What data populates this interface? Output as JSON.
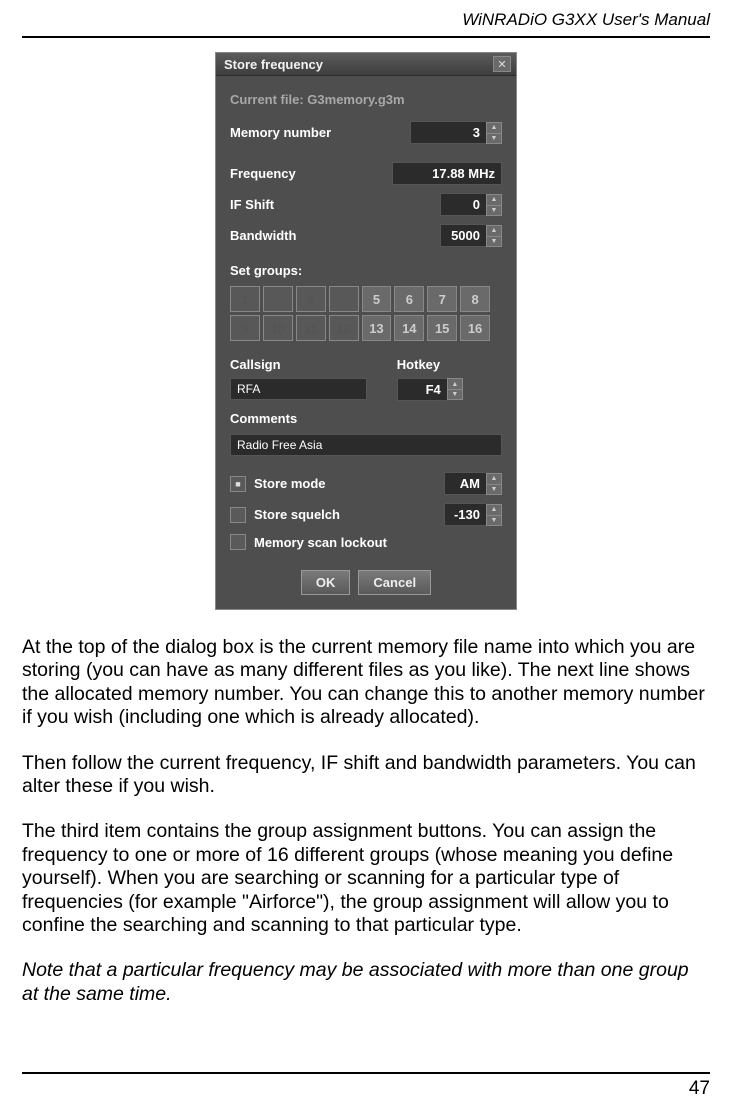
{
  "header": {
    "title": "WiNRADiO G3XX User's Manual"
  },
  "dialog": {
    "title": "Store frequency",
    "current_file_label": "Current file:",
    "current_file_value": "G3memory.g3m",
    "memory_number_label": "Memory number",
    "memory_number_value": "3",
    "frequency_label": "Frequency",
    "frequency_value": "17.88 MHz",
    "ifshift_label": "IF Shift",
    "ifshift_value": "0",
    "bandwidth_label": "Bandwidth",
    "bandwidth_value": "5000",
    "set_groups_label": "Set groups:",
    "groups": [
      "1",
      "",
      "3",
      "",
      "5",
      "6",
      "7",
      "8",
      "9",
      "10",
      "11",
      "12",
      "13",
      "14",
      "15",
      "16"
    ],
    "groups_dim": [
      true,
      true,
      true,
      true,
      false,
      false,
      false,
      false,
      true,
      true,
      true,
      true,
      false,
      false,
      false,
      false
    ],
    "callsign_label": "Callsign",
    "callsign_value": "RFA",
    "hotkey_label": "Hotkey",
    "hotkey_value": "F4",
    "comments_label": "Comments",
    "comments_value": "Radio Free Asia",
    "store_mode_label": "Store mode",
    "store_mode_value": "AM",
    "store_squelch_label": "Store squelch",
    "store_squelch_value": "-130",
    "lockout_label": "Memory scan lockout",
    "ok": "OK",
    "cancel": "Cancel"
  },
  "body": {
    "p1": "At the top of the dialog box is the current memory file name into which you are storing (you can have as many different files as you like). The next line shows the allocated memory number. You can change this to another memory number if you wish (including one which is already allocated).",
    "p2": "Then follow the current frequency, IF shift and bandwidth parameters. You can alter these if you wish.",
    "p3": "The third item contains the group assignment buttons. You can assign the frequency to one or more of 16 different groups (whose meaning you define yourself).  When you are searching or scanning for a particular type of frequencies (for example \"Airforce\"), the group assignment will allow you to confine the searching and scanning to that particular type.",
    "p4": "Note that a particular frequency may be associated with more than one group at the same time."
  },
  "footer": {
    "page": "47"
  }
}
